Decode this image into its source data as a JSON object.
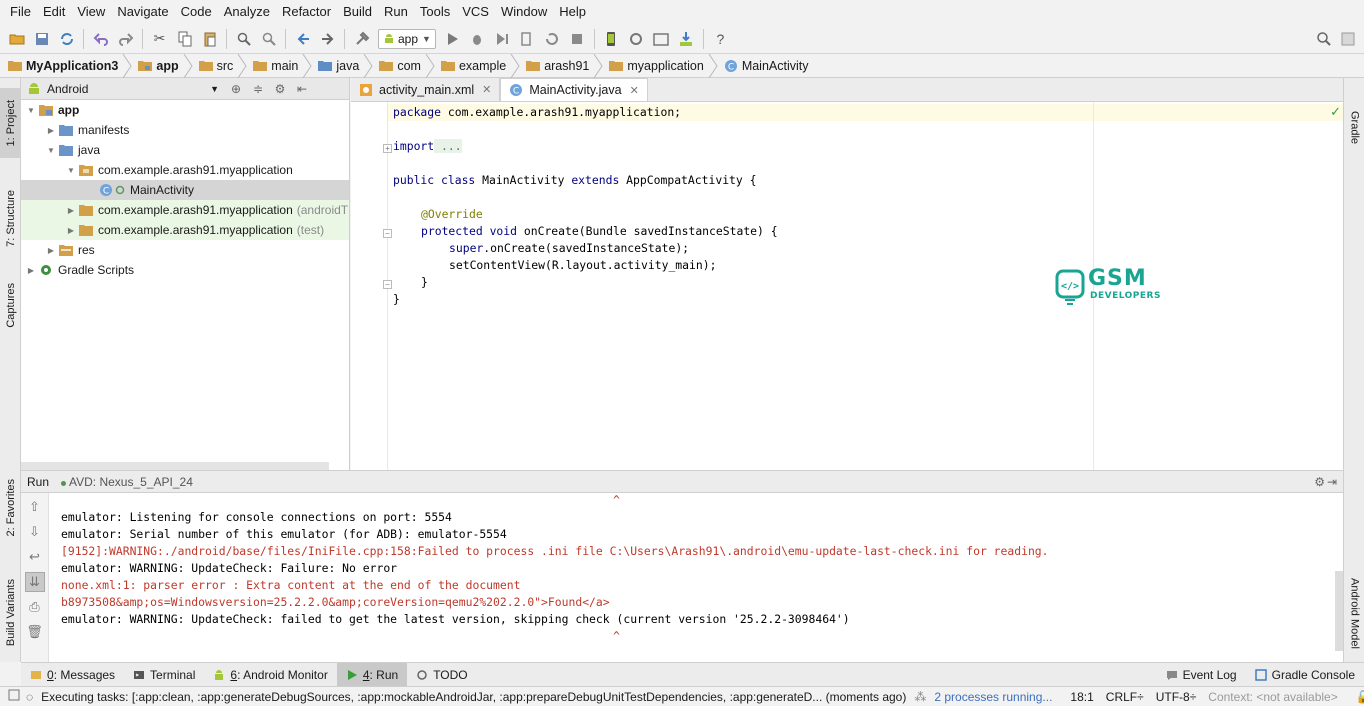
{
  "menu": [
    "File",
    "Edit",
    "View",
    "Navigate",
    "Code",
    "Analyze",
    "Refactor",
    "Build",
    "Run",
    "Tools",
    "VCS",
    "Window",
    "Help"
  ],
  "toolbar": {
    "run_config": "app"
  },
  "breadcrumb": [
    "MyApplication3",
    "app",
    "src",
    "main",
    "java",
    "com",
    "example",
    "arash91",
    "myapplication",
    "MainActivity"
  ],
  "left_stripe": {
    "project": "1: Project",
    "structure": "7: Structure",
    "captures": "Captures",
    "favorites": "2: Favorites",
    "build_variants": "Build Variants"
  },
  "right_stripe": {
    "gradle": "Gradle",
    "android_model": "Android Model"
  },
  "project_panel": {
    "view": "Android",
    "tree": [
      {
        "label": "app",
        "bold": true
      },
      {
        "label": "manifests"
      },
      {
        "label": "java"
      },
      {
        "label": "com.example.arash91.myapplication"
      },
      {
        "label": "MainActivity"
      },
      {
        "label": "com.example.arash91.myapplication",
        "suffix": "(androidT"
      },
      {
        "label": "com.example.arash91.myapplication",
        "suffix": "(test)"
      },
      {
        "label": "res"
      },
      {
        "label": "Gradle Scripts"
      }
    ]
  },
  "editor": {
    "tabs": [
      {
        "label": "activity_main.xml"
      },
      {
        "label": "MainActivity.java"
      }
    ],
    "code": [
      {
        "kw": "package",
        "rest": " com.example.arash91.myapplication;"
      },
      {
        "kw": "import",
        "rest": " ..."
      },
      {
        "kw": "public class",
        "mid": " MainActivity ",
        "kw2": "extends",
        "rest": " AppCompatActivity {"
      },
      {
        "ann": "@Override"
      },
      {
        "kw": "protected void",
        "rest": " onCreate(Bundle savedInstanceState) {"
      },
      {
        "kw": "super",
        "rest": ".onCreate(savedInstanceState);"
      },
      {
        "rest": "setContentView(R.layout.activity_main);"
      },
      {
        "rest": "}"
      },
      {
        "rest": "}"
      }
    ]
  },
  "watermark": {
    "name": "GSM",
    "sub": "DEVELOPERS"
  },
  "run_panel": {
    "title": "Run",
    "avd": "AVD: Nexus_5_API_24",
    "output": [
      {
        "text": "^",
        "type": "car"
      },
      {
        "text": "emulator: Listening for console connections on port: 5554",
        "type": "out"
      },
      {
        "text": "emulator: Serial number of this emulator (for ADB): emulator-5554",
        "type": "out"
      },
      {
        "text": "[9152]:WARNING:./android/base/files/IniFile.cpp:158:Failed to process .ini file C:\\Users\\Arash91\\.android\\emu-update-last-check.ini for reading.",
        "type": "err"
      },
      {
        "text": "emulator: WARNING: UpdateCheck: Failure: No error",
        "type": "out"
      },
      {
        "text": "none.xml:1: parser error : Extra content at the end of the document",
        "type": "err"
      },
      {
        "text": "b8973508&amp;os=Windowsversion=25.2.2.0&amp;coreVersion=qemu2%202.2.0\">Found</a>",
        "type": "err"
      },
      {
        "text": "emulator: WARNING: UpdateCheck: failed to get the latest version, skipping check (current version '25.2.2-3098464')",
        "type": "out"
      },
      {
        "text": "^",
        "type": "car"
      }
    ]
  },
  "bottom_bar": {
    "messages": {
      "key": "0",
      "label": ": Messages"
    },
    "terminal": "Terminal",
    "monitor": {
      "key": "6",
      "label": ": Android Monitor"
    },
    "run": {
      "key": "4",
      "label": ": Run"
    },
    "todo": "TODO",
    "event_log": "Event Log",
    "gradle_console": "Gradle Console"
  },
  "status": {
    "task": "Executing tasks: [:app:clean, :app:generateDebugSources, :app:mockableAndroidJar, :app:prepareDebugUnitTestDependencies, :app:generateD... (moments ago)",
    "processes": "2 processes running...",
    "position": "18:1",
    "line_sep": "CRLF÷",
    "encoding": "UTF-8÷",
    "context": "Context: <not available>"
  },
  "colors": {
    "keyword": "#000080",
    "annotation": "#808000",
    "error": "#c0392b",
    "caret_line": "#fffae3",
    "android_green": "#a4c639",
    "watermark": "#1aa592"
  }
}
